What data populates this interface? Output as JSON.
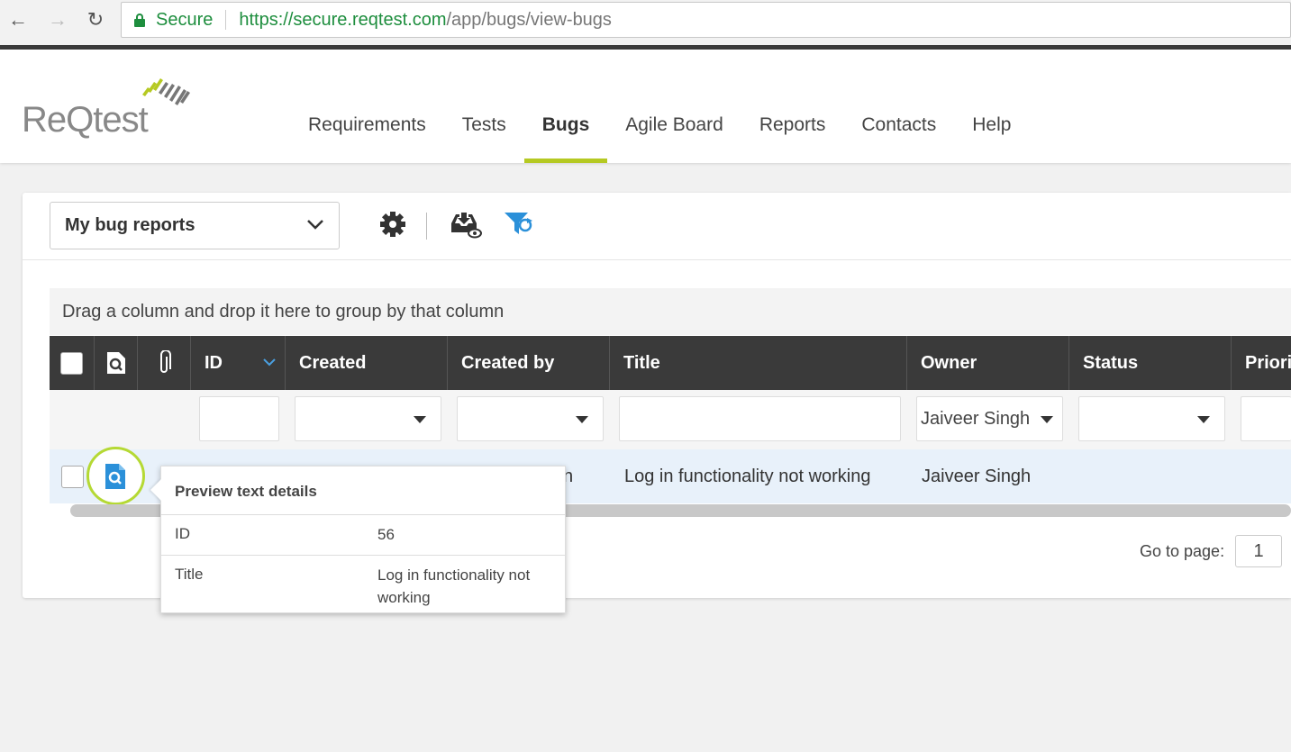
{
  "browser": {
    "secure_label": "Secure",
    "url_host": "https://secure.reqtest.com",
    "url_path": "/app/bugs/view-bugs"
  },
  "app": {
    "logo_text": "ReQtest",
    "nav": [
      {
        "label": "Requirements",
        "active": false
      },
      {
        "label": "Tests",
        "active": false
      },
      {
        "label": "Bugs",
        "active": true
      },
      {
        "label": "Agile Board",
        "active": false
      },
      {
        "label": "Reports",
        "active": false
      },
      {
        "label": "Contacts",
        "active": false
      },
      {
        "label": "Help",
        "active": false
      }
    ],
    "accent_color": "#b5c922"
  },
  "toolbar": {
    "view_selected": "My bug reports",
    "icons": [
      "gear-icon",
      "inbox-download-eye-icon",
      "filter-refresh-icon"
    ]
  },
  "grid": {
    "group_hint": "Drag a column and drop it here to group by that column",
    "columns": [
      "ID",
      "Created",
      "Created by",
      "Title",
      "Owner",
      "Status",
      "Priori"
    ],
    "filters": {
      "owner": "Jaiveer Singh"
    },
    "rows": [
      {
        "created_by_fragment": "n",
        "title": "Log in functionality not working",
        "owner": "Jaiveer Singh"
      }
    ],
    "goto_label": "Go to page:",
    "goto_value": "1"
  },
  "tooltip": {
    "title": "Preview text details",
    "rows": [
      {
        "key": "ID",
        "value": "56"
      },
      {
        "key": "Title",
        "value": "Log in functionality not working"
      }
    ]
  }
}
